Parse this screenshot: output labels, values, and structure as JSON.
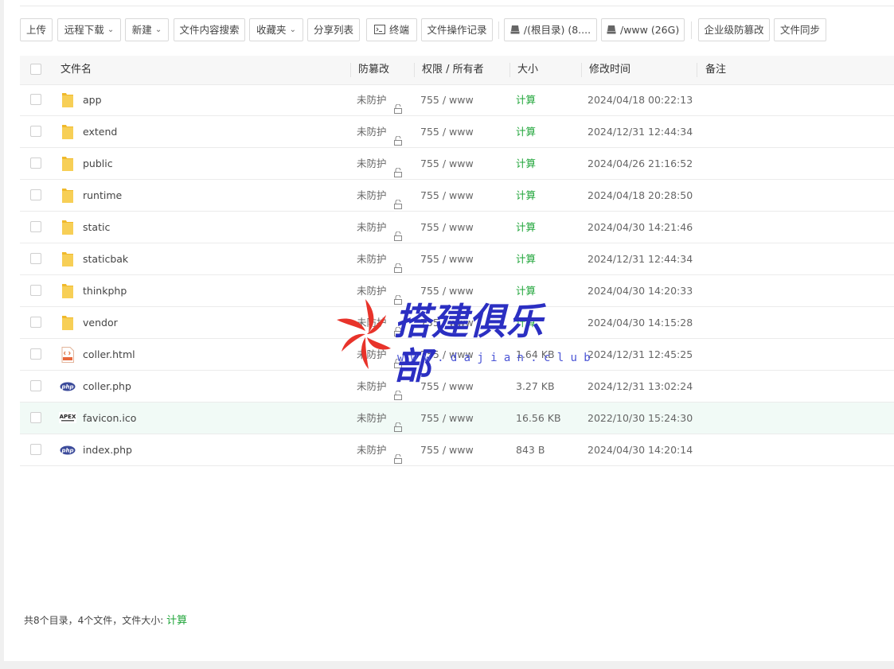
{
  "toolbar": {
    "upload": "上传",
    "remote_download": "远程下载",
    "new": "新建",
    "content_search": "文件内容搜索",
    "favorites": "收藏夹",
    "share_list": "分享列表",
    "terminal": "终端",
    "op_log": "文件操作记录",
    "disk_root": "/(根目录) (8....",
    "disk_www": "/www (26G)",
    "enterprise_tamper": "企业级防篡改",
    "file_sync": "文件同步"
  },
  "table": {
    "headers": {
      "name": "文件名",
      "tamper": "防篡改",
      "perm_owner": "权限 / 所有者",
      "size": "大小",
      "mtime": "修改时间",
      "note": "备注"
    },
    "rows": [
      {
        "name": "app",
        "type": "folder",
        "tamper": "未防护",
        "perm": "755 / www",
        "size": "计算",
        "mtime": "2024/04/18 00:22:13"
      },
      {
        "name": "extend",
        "type": "folder",
        "tamper": "未防护",
        "perm": "755 / www",
        "size": "计算",
        "mtime": "2024/12/31 12:44:34"
      },
      {
        "name": "public",
        "type": "folder",
        "tamper": "未防护",
        "perm": "755 / www",
        "size": "计算",
        "mtime": "2024/04/26 21:16:52"
      },
      {
        "name": "runtime",
        "type": "folder",
        "tamper": "未防护",
        "perm": "755 / www",
        "size": "计算",
        "mtime": "2024/04/18 20:28:50"
      },
      {
        "name": "static",
        "type": "folder",
        "tamper": "未防护",
        "perm": "755 / www",
        "size": "计算",
        "mtime": "2024/04/30 14:21:46"
      },
      {
        "name": "staticbak",
        "type": "folder",
        "tamper": "未防护",
        "perm": "755 / www",
        "size": "计算",
        "mtime": "2024/12/31 12:44:34"
      },
      {
        "name": "thinkphp",
        "type": "folder",
        "tamper": "未防护",
        "perm": "755 / www",
        "size": "计算",
        "mtime": "2024/04/30 14:20:33"
      },
      {
        "name": "vendor",
        "type": "folder",
        "tamper": "未防护",
        "perm": "755 / www",
        "size": "计算",
        "mtime": "2024/04/30 14:15:28"
      },
      {
        "name": "coller.html",
        "type": "html",
        "tamper": "未防护",
        "perm": "755 / www",
        "size": "1.64 KB",
        "mtime": "2024/12/31 12:45:25"
      },
      {
        "name": "coller.php",
        "type": "php",
        "tamper": "未防护",
        "perm": "755 / www",
        "size": "3.27 KB",
        "mtime": "2024/12/31 13:02:24"
      },
      {
        "name": "favicon.ico",
        "type": "ico",
        "tamper": "未防护",
        "perm": "755 / www",
        "size": "16.56 KB",
        "mtime": "2022/10/30 15:24:30"
      },
      {
        "name": "index.php",
        "type": "php",
        "tamper": "未防护",
        "perm": "755 / www",
        "size": "843 B",
        "mtime": "2024/04/30 14:20:14"
      }
    ]
  },
  "footer": {
    "summary": "共8个目录，4个文件，文件大小:",
    "calc": "计算"
  },
  "watermark": {
    "title": "搭建俱乐部",
    "url": "www.dajian.club"
  },
  "colors": {
    "accent_green": "#20a53a",
    "folder_yellow": "#f5c343",
    "php_badge": "#3b4a9a",
    "watermark_blue": "#2b2fc2",
    "watermark_red": "#e8332a"
  }
}
